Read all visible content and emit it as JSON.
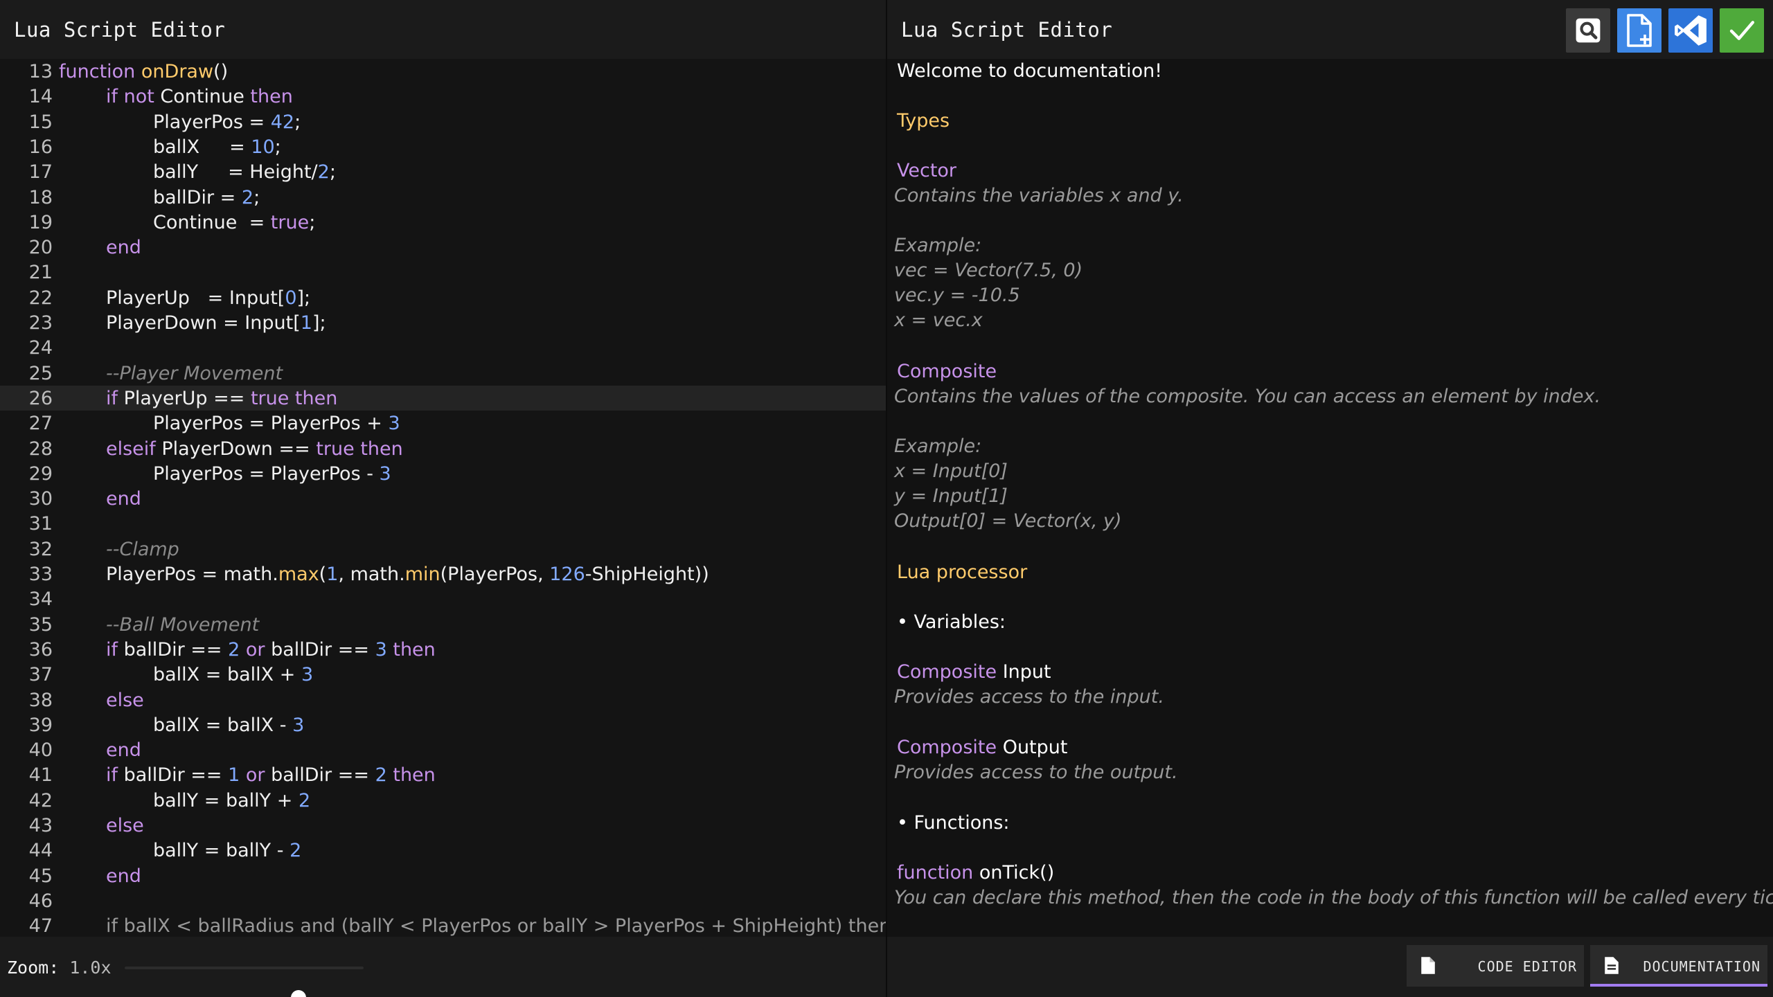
{
  "left_pane": {
    "title": "Lua Script Editor",
    "zoom_label": "Zoom:",
    "zoom_value": "1.0x"
  },
  "right_pane": {
    "title": "Lua Script Editor"
  },
  "toolbar": {
    "icons": [
      "search-icon",
      "new-file-icon",
      "vscode-icon",
      "checkmark-icon"
    ],
    "colors": {
      "search": "#3a3a3a",
      "new_file": "#3d87e6",
      "vscode": "#2d74d9",
      "apply": "#4faa3b"
    }
  },
  "code": {
    "current_line": "26",
    "lines": [
      {
        "n": "13",
        "t": "function onDraw()"
      },
      {
        "n": "14",
        "t": "if not Continue then"
      },
      {
        "n": "15",
        "t": "PlayerPos = 42;"
      },
      {
        "n": "16",
        "t": "ballX     = 10;"
      },
      {
        "n": "17",
        "t": "ballY     = Height/2;"
      },
      {
        "n": "18",
        "t": "ballDir = 2;"
      },
      {
        "n": "19",
        "t": "Continue  = true;"
      },
      {
        "n": "20",
        "t": "end"
      },
      {
        "n": "21",
        "t": ""
      },
      {
        "n": "22",
        "t": "PlayerUp   = Input[0];"
      },
      {
        "n": "23",
        "t": "PlayerDown = Input[1];"
      },
      {
        "n": "24",
        "t": ""
      },
      {
        "n": "25",
        "t": "--Player Movement"
      },
      {
        "n": "26",
        "t": "if PlayerUp == true then"
      },
      {
        "n": "27",
        "t": "PlayerPos = PlayerPos + 3"
      },
      {
        "n": "28",
        "t": "elseif PlayerDown == true then"
      },
      {
        "n": "29",
        "t": "PlayerPos = PlayerPos - 3"
      },
      {
        "n": "30",
        "t": "end"
      },
      {
        "n": "31",
        "t": ""
      },
      {
        "n": "32",
        "t": "--Clamp"
      },
      {
        "n": "33",
        "t": "PlayerPos = math.max(1, math.min(PlayerPos, 126-ShipHeight))"
      },
      {
        "n": "34",
        "t": ""
      },
      {
        "n": "35",
        "t": "--Ball Movement"
      },
      {
        "n": "36",
        "t": "if ballDir == 2 or ballDir == 3 then"
      },
      {
        "n": "37",
        "t": "ballX = ballX + 3"
      },
      {
        "n": "38",
        "t": "else"
      },
      {
        "n": "39",
        "t": "ballX = ballX - 3"
      },
      {
        "n": "40",
        "t": "end"
      },
      {
        "n": "41",
        "t": "if ballDir == 1 or ballDir == 2 then"
      },
      {
        "n": "42",
        "t": "ballY = ballY + 2"
      },
      {
        "n": "43",
        "t": "else"
      },
      {
        "n": "44",
        "t": "ballY = ballY - 2"
      },
      {
        "n": "45",
        "t": "end"
      },
      {
        "n": "46",
        "t": ""
      },
      {
        "n": "47",
        "t": "if ballX < ballRadius and (ballY < PlayerPos or ballY > PlayerPos + ShipHeight) then"
      }
    ]
  },
  "doc": {
    "welcome": "Welcome to documentation!",
    "types_heading": "Types",
    "vector_title": "Vector",
    "vector_desc": "Contains the variables x and y.",
    "vector_example_label": "Example:",
    "vector_example_1": "vec = Vector(7.5, 0)",
    "vector_example_2": "vec.y = -10.5",
    "vector_example_3": "x = vec.x",
    "composite_title": "Composite",
    "composite_desc": "Contains the values of the composite. You can access an element by index.",
    "composite_example_label": "Example:",
    "composite_example_1": "x = Input[0]",
    "composite_example_2": "y = Input[1]",
    "composite_example_3": "Output[0] = Vector(x, y)",
    "lua_heading": "Lua processor",
    "variables_label": "• Variables:",
    "input_type": "Composite",
    "input_name": " Input",
    "input_desc": "Provides access to the input.",
    "output_type": "Composite",
    "output_name": " Output",
    "output_desc": "Provides access to the output.",
    "functions_label": "• Functions:",
    "ontick_keyword": "function",
    "ontick_name": " onTick()",
    "ontick_desc": "You can declare this method, then the code in the body of this function will be called every tick."
  },
  "tabs": {
    "code_editor": "CODE EDITOR",
    "documentation": "DOCUMENTATION",
    "active_color": "#a27cf0"
  }
}
